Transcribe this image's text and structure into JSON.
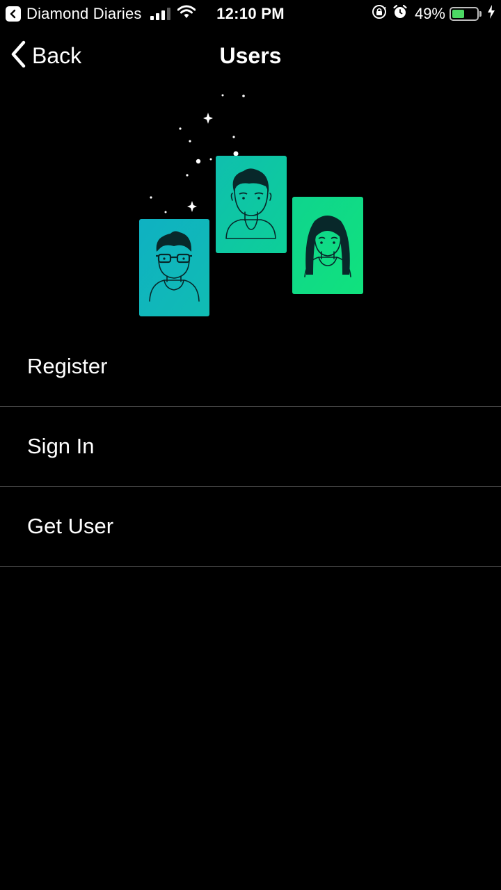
{
  "status_bar": {
    "return_app": "Diamond Diaries",
    "time": "12:10 PM",
    "battery_percent": "49%",
    "battery_level": 0.49,
    "signal_bars_active": 3,
    "signal_bars_total": 4,
    "icons": [
      "back-to-app-icon",
      "signal-icon",
      "wifi-icon",
      "orientation-lock-icon",
      "alarm-icon",
      "battery-icon",
      "charging-bolt-icon"
    ]
  },
  "nav": {
    "back_label": "Back",
    "title": "Users",
    "back_icon": "chevron-left-icon"
  },
  "illustration": {
    "description_icon": "user-cards-illustration",
    "colors": {
      "card_left": "#10b3bf",
      "card_middle": "#0ec6a6",
      "card_right": "#0fdb84",
      "line": "#0a2a2a",
      "sparkle": "#ffffff"
    }
  },
  "menu": {
    "items": [
      {
        "label": "Register"
      },
      {
        "label": "Sign In"
      },
      {
        "label": "Get User"
      }
    ]
  },
  "colors": {
    "background": "#000000",
    "text": "#ffffff",
    "separator": "#4a4a4a",
    "battery_fill": "#4cd964"
  }
}
